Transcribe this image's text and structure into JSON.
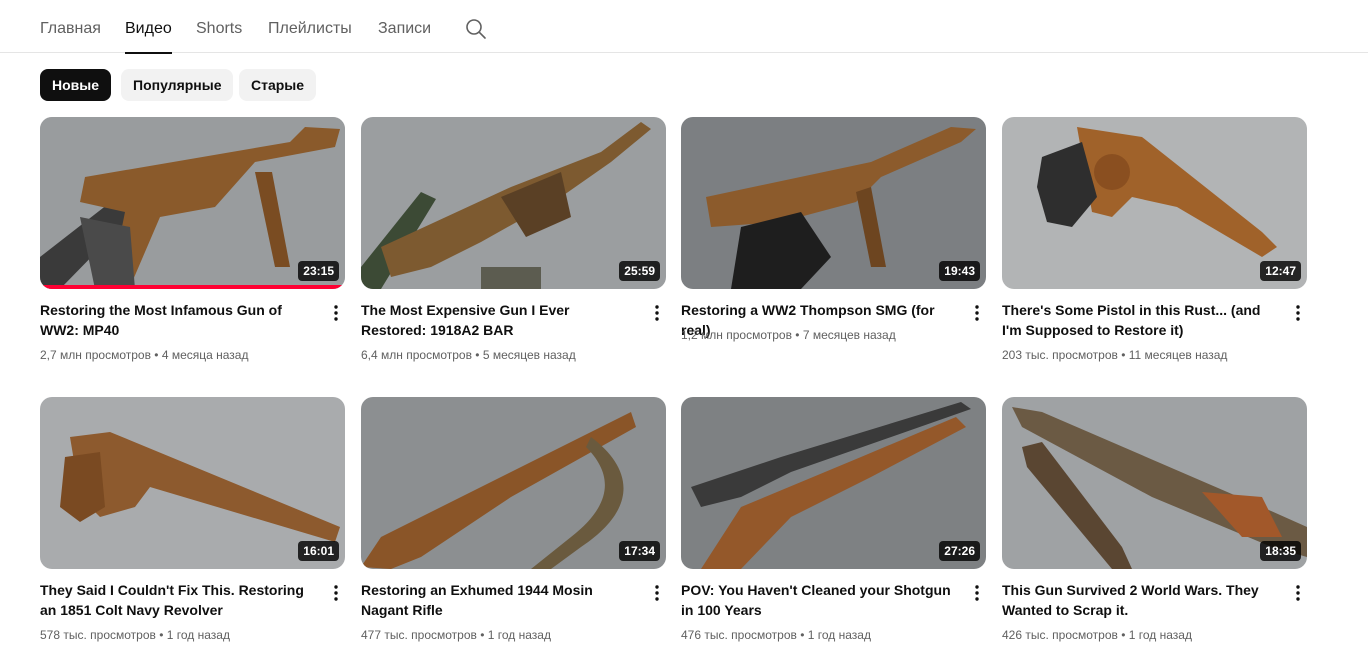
{
  "tabs": [
    {
      "label": "Главная",
      "active": false
    },
    {
      "label": "Видео",
      "active": true
    },
    {
      "label": "Shorts",
      "active": false
    },
    {
      "label": "Плейлисты",
      "active": false
    },
    {
      "label": "Записи",
      "active": false
    }
  ],
  "search": {
    "icon": "search-icon"
  },
  "chips": [
    {
      "label": "Новые",
      "active": true
    },
    {
      "label": "Популярные",
      "active": false
    },
    {
      "label": "Старые",
      "active": false
    }
  ],
  "videos": [
    {
      "title": "Restoring the Most Infamous Gun of WW2: MP40",
      "duration": "23:15",
      "views": "2,7 млн просмотров",
      "age": "4 месяца назад",
      "watch_progress": 1.0
    },
    {
      "title": "The Most Expensive Gun I Ever Restored: 1918A2 BAR",
      "duration": "25:59",
      "views": "6,4 млн просмотров",
      "age": "5 месяцев назад"
    },
    {
      "title": "Restoring a WW2 Thompson SMG (for real)",
      "duration": "19:43",
      "views": "1,2 млн просмотров",
      "age": "7 месяцев назад"
    },
    {
      "title": "There's Some Pistol in this Rust... (and I'm Supposed to Restore it)",
      "duration": "12:47",
      "views": "203 тыс. просмотров",
      "age": "11 месяцев назад"
    },
    {
      "title": "They Said I Couldn't Fix This. Restoring an 1851 Colt Navy Revolver",
      "duration": "16:01",
      "views": "578 тыс. просмотров",
      "age": "1 год назад"
    },
    {
      "title": "Restoring an Exhumed 1944 Mosin Nagant Rifle",
      "duration": "17:34",
      "views": "477 тыс. просмотров",
      "age": "1 год назад"
    },
    {
      "title": "POV: You Haven't Cleaned your Shotgun in 100 Years",
      "duration": "27:26",
      "views": "476 тыс. просмотров",
      "age": "1 год назад"
    },
    {
      "title": "This Gun Survived 2 World Wars. They Wanted to Scrap it.",
      "duration": "18:35",
      "views": "426 тыс. просмотров",
      "age": "1 год назад"
    }
  ],
  "colors": {
    "accent": "#0f0f0f",
    "progress": "#ff0033",
    "meta_text": "#606060"
  }
}
